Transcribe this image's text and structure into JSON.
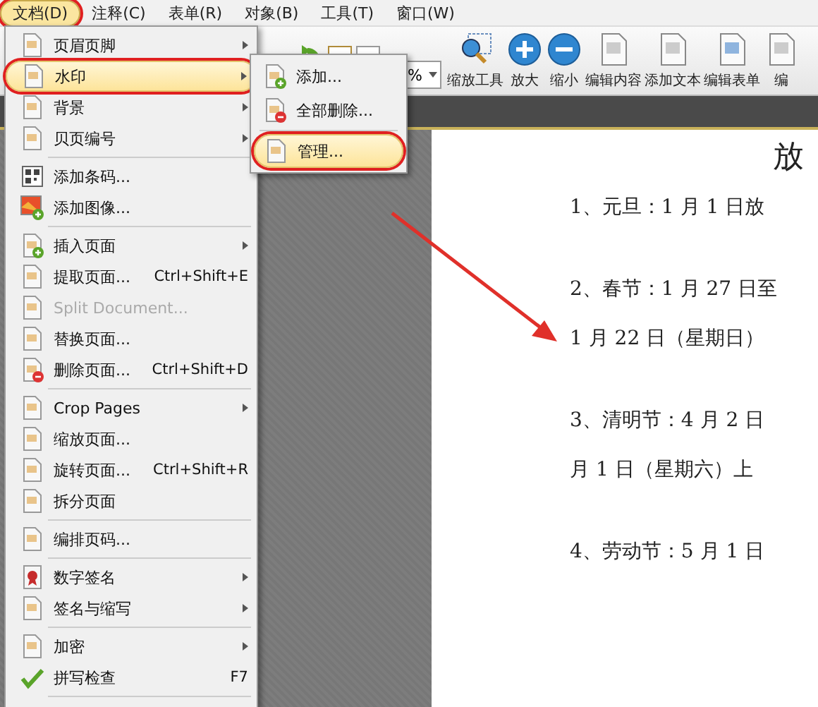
{
  "menubar": [
    {
      "label": "文档(D)",
      "selected": true,
      "circled": true
    },
    {
      "label": "注释(C)",
      "selected": false,
      "circled": false
    },
    {
      "label": "表单(R)",
      "selected": false,
      "circled": false
    },
    {
      "label": "对象(B)",
      "selected": false,
      "circled": false
    },
    {
      "label": "工具(T)",
      "selected": false,
      "circled": false
    },
    {
      "label": "窗口(W)",
      "selected": false,
      "circled": false
    }
  ],
  "toolbar": {
    "zoom_field": {
      "value": "%"
    },
    "buttons": [
      {
        "label": "缩放工具"
      },
      {
        "label": "放大"
      },
      {
        "label": "缩小"
      },
      {
        "label": "编辑内容"
      },
      {
        "label": "添加文本"
      },
      {
        "label": "编辑表单"
      },
      {
        "label": "编"
      }
    ]
  },
  "menu": {
    "items": [
      {
        "kind": "item",
        "label": "页眉页脚",
        "submenu": true,
        "disabled": false,
        "selected": false,
        "circled": false
      },
      {
        "kind": "item",
        "label": "水印",
        "submenu": true,
        "disabled": false,
        "selected": true,
        "circled": true
      },
      {
        "kind": "item",
        "label": "背景",
        "submenu": true,
        "disabled": false,
        "selected": false,
        "circled": false
      },
      {
        "kind": "item",
        "label": "贝页编号",
        "submenu": true,
        "disabled": false,
        "selected": false,
        "circled": false
      },
      {
        "kind": "separator"
      },
      {
        "kind": "item",
        "label": "添加条码...",
        "submenu": false,
        "disabled": false,
        "selected": false,
        "circled": false
      },
      {
        "kind": "item",
        "label": "添加图像...",
        "submenu": false,
        "disabled": false,
        "selected": false,
        "circled": false
      },
      {
        "kind": "separator"
      },
      {
        "kind": "item",
        "label": "插入页面",
        "submenu": true,
        "disabled": false,
        "selected": false,
        "circled": false
      },
      {
        "kind": "item",
        "label": "提取页面...",
        "shortcut": "Ctrl+Shift+E",
        "submenu": false,
        "disabled": false,
        "selected": false,
        "circled": false
      },
      {
        "kind": "item",
        "label": "Split Document...",
        "submenu": false,
        "disabled": true,
        "selected": false,
        "circled": false
      },
      {
        "kind": "item",
        "label": "替换页面...",
        "submenu": false,
        "disabled": false,
        "selected": false,
        "circled": false
      },
      {
        "kind": "item",
        "label": "删除页面...",
        "shortcut": "Ctrl+Shift+D",
        "submenu": false,
        "disabled": false,
        "selected": false,
        "circled": false
      },
      {
        "kind": "separator"
      },
      {
        "kind": "item",
        "label": "Crop Pages",
        "submenu": true,
        "disabled": false,
        "selected": false,
        "circled": false
      },
      {
        "kind": "item",
        "label": "缩放页面...",
        "submenu": false,
        "disabled": false,
        "selected": false,
        "circled": false
      },
      {
        "kind": "item",
        "label": "旋转页面...",
        "shortcut": "Ctrl+Shift+R",
        "submenu": false,
        "disabled": false,
        "selected": false,
        "circled": false
      },
      {
        "kind": "item",
        "label": "拆分页面",
        "submenu": false,
        "disabled": false,
        "selected": false,
        "circled": false
      },
      {
        "kind": "separator"
      },
      {
        "kind": "item",
        "label": "编排页码...",
        "submenu": false,
        "disabled": false,
        "selected": false,
        "circled": false
      },
      {
        "kind": "separator"
      },
      {
        "kind": "item",
        "label": "数字签名",
        "submenu": true,
        "disabled": false,
        "selected": false,
        "circled": false
      },
      {
        "kind": "item",
        "label": "签名与缩写",
        "submenu": true,
        "disabled": false,
        "selected": false,
        "circled": false
      },
      {
        "kind": "separator"
      },
      {
        "kind": "item",
        "label": "加密",
        "submenu": true,
        "disabled": false,
        "selected": false,
        "circled": false
      },
      {
        "kind": "item",
        "label": "拼写检查",
        "shortcut": "F7",
        "submenu": false,
        "disabled": false,
        "selected": false,
        "circled": false
      },
      {
        "kind": "separator"
      }
    ]
  },
  "submenu": {
    "items": [
      {
        "kind": "item",
        "label": "添加...",
        "selected": false,
        "circled": false
      },
      {
        "kind": "item",
        "label": "全部删除...",
        "selected": false,
        "circled": false
      },
      {
        "kind": "separator"
      },
      {
        "kind": "item",
        "label": "管理...",
        "selected": true,
        "circled": true
      }
    ]
  },
  "document": {
    "title": "放",
    "paragraphs": [
      {
        "lines": [
          "1、元旦：1 月 1 日放"
        ]
      },
      {
        "lines": [
          "2、春节：1 月 27 日至",
          "1 月 22 日（星期日）"
        ]
      },
      {
        "lines": [
          "3、清明节：4 月 2 日",
          "月 1 日（星期六）上"
        ]
      },
      {
        "lines": [
          "4、劳动节：5 月 1 日"
        ]
      }
    ]
  }
}
